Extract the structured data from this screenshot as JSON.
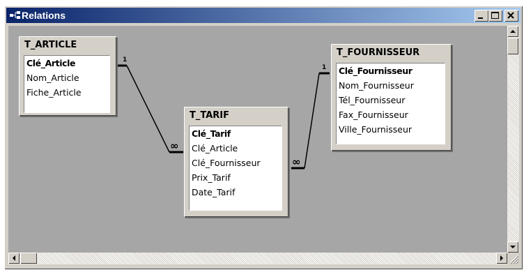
{
  "window": {
    "title": "Relations",
    "icon": "relationships-icon"
  },
  "title_buttons": [
    "minimize",
    "maximize",
    "close"
  ],
  "tables": [
    {
      "name": "T_ARTICLE",
      "fields": [
        {
          "label": "Clé_Article",
          "primary_key": true
        },
        {
          "label": "Nom_Article",
          "primary_key": false
        },
        {
          "label": "Fiche_Article",
          "primary_key": false
        }
      ]
    },
    {
      "name": "T_TARIF",
      "fields": [
        {
          "label": "Clé_Tarif",
          "primary_key": true
        },
        {
          "label": "Clé_Article",
          "primary_key": false
        },
        {
          "label": "Clé_Fournisseur",
          "primary_key": false
        },
        {
          "label": "Prix_Tarif",
          "primary_key": false
        },
        {
          "label": "Date_Tarif",
          "primary_key": false
        }
      ]
    },
    {
      "name": "T_FOURNISSEUR",
      "fields": [
        {
          "label": "Clé_Fournisseur",
          "primary_key": true
        },
        {
          "label": "Nom_Fournisseur",
          "primary_key": false
        },
        {
          "label": "Tél_Fournisseur",
          "primary_key": false
        },
        {
          "label": "Fax_Fournisseur",
          "primary_key": false
        },
        {
          "label": "Ville_Fournisseur",
          "primary_key": false
        }
      ]
    }
  ],
  "relationships": [
    {
      "from_table": "T_ARTICLE",
      "from_field": "Clé_Article",
      "to_table": "T_TARIF",
      "to_field": "Clé_Article",
      "one_label": "1",
      "many_label": "∞"
    },
    {
      "from_table": "T_FOURNISSEUR",
      "from_field": "Clé_Fournisseur",
      "to_table": "T_TARIF",
      "to_field": "Clé_Fournisseur",
      "one_label": "1",
      "many_label": "∞"
    }
  ]
}
